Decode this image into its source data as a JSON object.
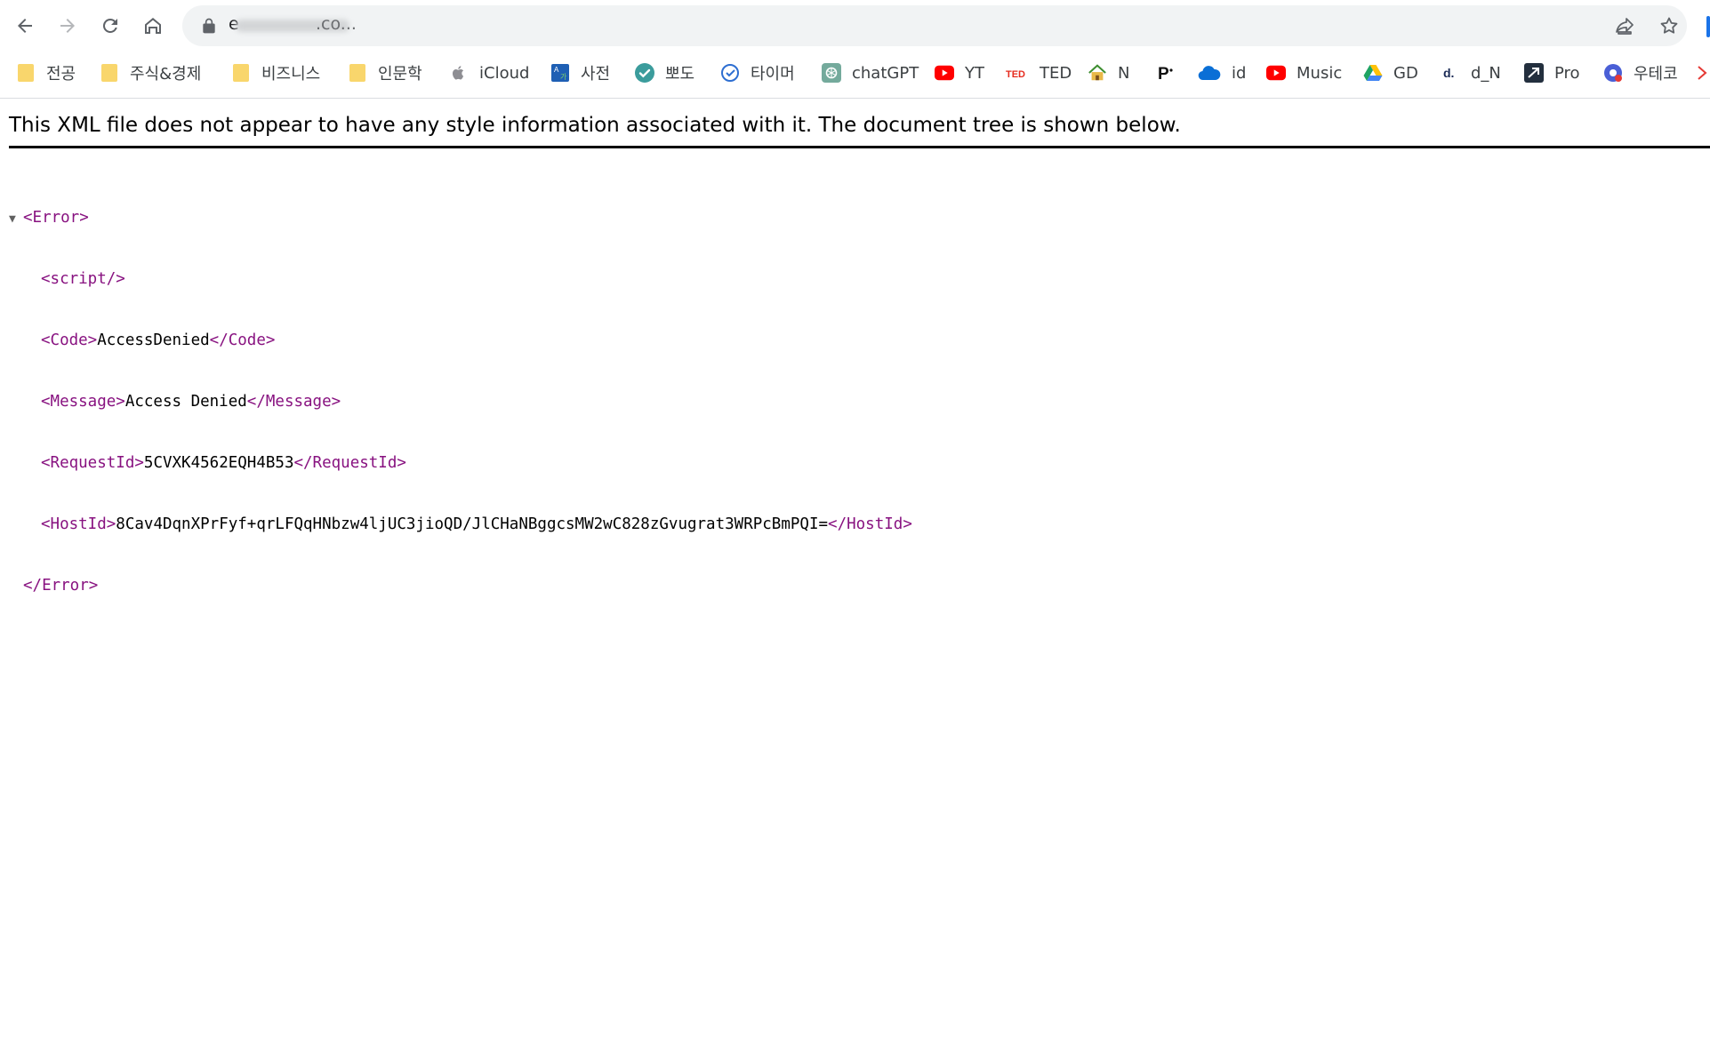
{
  "browser": {
    "address_bar": {
      "url_visible_prefix": "e",
      "url_visible_suffix": ".co..."
    }
  },
  "bookmarks": [
    {
      "label": "전공",
      "icon": "folder-icon"
    },
    {
      "label": "주식&경제",
      "icon": "folder-icon"
    },
    {
      "label": "비즈니스",
      "icon": "folder-icon"
    },
    {
      "label": "인문학",
      "icon": "folder-icon"
    },
    {
      "label": "iCloud",
      "icon": "apple-icon"
    },
    {
      "label": "사전",
      "icon": "dictionary-icon"
    },
    {
      "label": "뽀도",
      "icon": "check-circle-icon"
    },
    {
      "label": "타이머",
      "icon": "timer-icon"
    },
    {
      "label": "chatGPT",
      "icon": "openai-icon"
    },
    {
      "label": "YT",
      "icon": "youtube-icon"
    },
    {
      "label": "TED",
      "icon": "ted-icon"
    },
    {
      "label": "N",
      "icon": "house-icon"
    },
    {
      "label": "",
      "icon": "p-logo-icon"
    },
    {
      "label": "id",
      "icon": "cloud-icon"
    },
    {
      "label": "Music",
      "icon": "youtube-music-icon"
    },
    {
      "label": "GD",
      "icon": "google-drive-icon"
    },
    {
      "label": "d_N",
      "icon": "d-logo-icon"
    },
    {
      "label": "Pro",
      "icon": "pro-logo-icon"
    },
    {
      "label": "우테코",
      "icon": "chrome-profile-icon"
    }
  ],
  "xml_viewer": {
    "header": "This XML file does not appear to have any style information associated with it. The document tree is shown below.",
    "tree": {
      "root_open": "<Error>",
      "script": "<script/>",
      "code_open": "<Code>",
      "code_value": "AccessDenied",
      "code_close": "</Code>",
      "message_open": "<Message>",
      "message_value": "Access Denied",
      "message_close": "</Message>",
      "request_open": "<RequestId>",
      "request_value": "5CVXK4562EQH4B53",
      "request_close": "</RequestId>",
      "host_open": "<HostId>",
      "host_value": "8Cav4DqnXPrFyf+qrLFQqHNbzw4ljUC3jioQD/JlCHaNBggcsMW2wC828zGvugrat3WRPcBmPQI=",
      "host_close": "</HostId>",
      "root_close": "</Error>"
    }
  },
  "colors": {
    "xml_tag": "#881280",
    "folder": "#f9d66c",
    "omnibox_bg": "#f1f3f4"
  }
}
